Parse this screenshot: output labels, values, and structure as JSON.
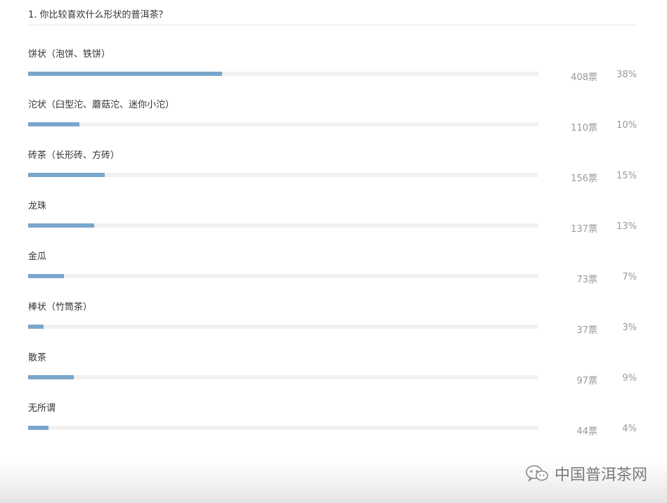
{
  "survey": {
    "question": "1. 你比较喜欢什么形状的普洱茶？",
    "options": [
      {
        "label": "饼状（泡饼、铁饼）",
        "votes": "408票",
        "percent": "38%",
        "fraction": 0.38
      },
      {
        "label": "沱状（臼型沱、蘑菇沱、迷你小沱）",
        "votes": "110票",
        "percent": "10%",
        "fraction": 0.1
      },
      {
        "label": "砖茶（长形砖、方砖）",
        "votes": "156票",
        "percent": "15%",
        "fraction": 0.15
      },
      {
        "label": "龙珠",
        "votes": "137票",
        "percent": "13%",
        "fraction": 0.13
      },
      {
        "label": "金瓜",
        "votes": "73票",
        "percent": "7%",
        "fraction": 0.07
      },
      {
        "label": "棒状（竹筒茶）",
        "votes": "37票",
        "percent": "3%",
        "fraction": 0.03
      },
      {
        "label": "散茶",
        "votes": "97票",
        "percent": "9%",
        "fraction": 0.09
      },
      {
        "label": "无所谓",
        "votes": "44票",
        "percent": "4%",
        "fraction": 0.04
      }
    ]
  },
  "watermark": {
    "text": "中国普洱茶网",
    "icon": "wechat-icon"
  },
  "colors": {
    "bar_fill": "#7aa6cc",
    "bar_track": "#f1f1f1",
    "muted_text": "#999999"
  }
}
